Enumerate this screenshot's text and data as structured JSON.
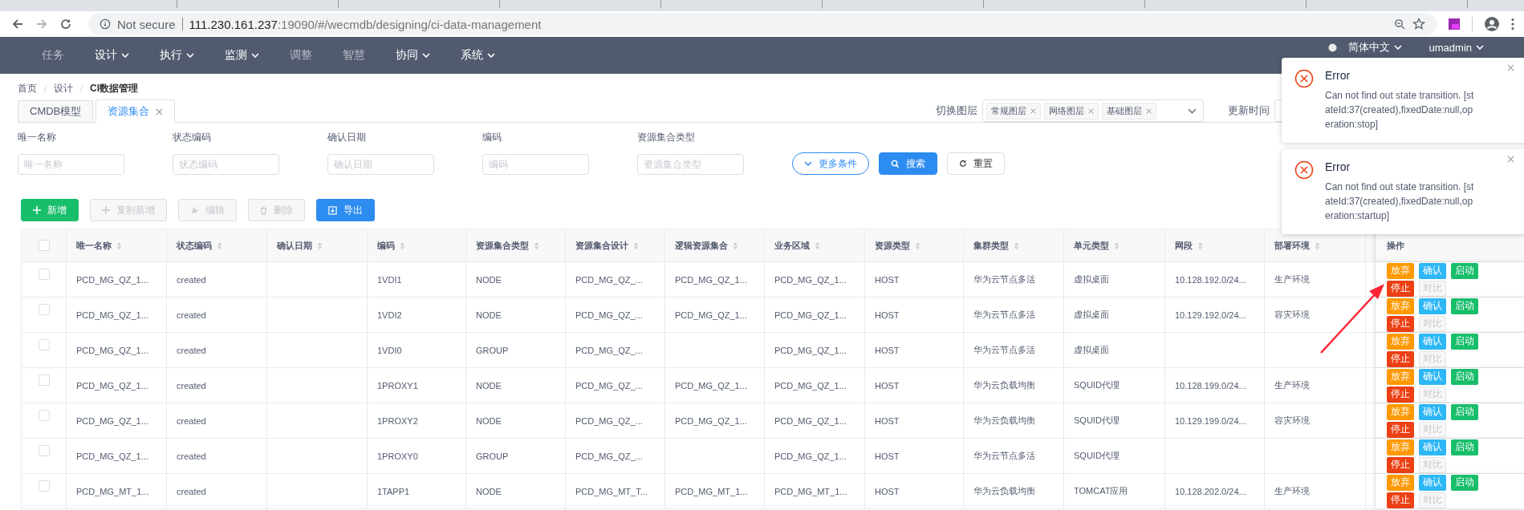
{
  "browser": {
    "security": "Not secure",
    "url_host": "111.230.161.237",
    "url_rest": ":19090/#/wecmdb/designing/ci-data-management"
  },
  "nav": {
    "items": [
      {
        "label": "任务",
        "has_menu": false,
        "dim": true
      },
      {
        "label": "设计",
        "has_menu": true,
        "dim": false
      },
      {
        "label": "执行",
        "has_menu": true,
        "dim": false
      },
      {
        "label": "监测",
        "has_menu": true,
        "dim": false
      },
      {
        "label": "调整",
        "has_menu": false,
        "dim": true
      },
      {
        "label": "智慧",
        "has_menu": false,
        "dim": true
      },
      {
        "label": "协同",
        "has_menu": true,
        "dim": false
      },
      {
        "label": "系统",
        "has_menu": true,
        "dim": false
      }
    ],
    "language": "简体中文",
    "user": "umadmin"
  },
  "breadcrumb": [
    {
      "label": "首页",
      "current": false
    },
    {
      "label": "设计",
      "current": false
    },
    {
      "label": "CI数据管理",
      "current": true
    }
  ],
  "tabs": [
    {
      "label": "CMDB模型",
      "selected": false,
      "closable": false
    },
    {
      "label": "资源集合",
      "selected": true,
      "closable": true
    }
  ],
  "layer_switch": {
    "label": "切换图层",
    "tags": [
      "常规图层",
      "网络图层",
      "基础图层"
    ]
  },
  "update_time": {
    "label": "更新时间"
  },
  "filters": [
    {
      "label": "唯一名称",
      "placeholder": "唯一名称"
    },
    {
      "label": "状态编码",
      "placeholder": "状态编码"
    },
    {
      "label": "确认日期",
      "placeholder": "确认日期"
    },
    {
      "label": "编码",
      "placeholder": "编码"
    },
    {
      "label": "资源集合类型",
      "placeholder": "资源集合类型"
    }
  ],
  "filter_buttons": [
    {
      "label": "更多条件",
      "kind": "more"
    },
    {
      "label": "搜索",
      "kind": "search"
    },
    {
      "label": "重置",
      "kind": "reset"
    }
  ],
  "toolbar": [
    {
      "label": "新增",
      "kind": "add",
      "disabled": false
    },
    {
      "label": "复制新增",
      "kind": "copy",
      "disabled": true
    },
    {
      "label": "编辑",
      "kind": "edit",
      "disabled": true
    },
    {
      "label": "删除",
      "kind": "delete",
      "disabled": true
    },
    {
      "label": "导出",
      "kind": "export",
      "disabled": false
    }
  ],
  "table": {
    "header_checked": false,
    "columns": [
      "唯一名称",
      "状态编码",
      "确认日期",
      "编码",
      "资源集合类型",
      "资源集合设计",
      "逻辑资源集合",
      "业务区域",
      "资源类型",
      "集群类型",
      "单元类型",
      "网段",
      "部署环境"
    ],
    "actions_column": "操作",
    "rows": [
      {
        "selected": false,
        "cells": [
          "PCD_MG_QZ_1...",
          "created",
          null,
          "1VDI1",
          "NODE",
          "PCD_MG_QZ_...",
          "PCD_MG_QZ_1...",
          "PCD_MG_QZ_1...",
          "HOST",
          "华为云节点多活",
          "虚拟桌面",
          "10.128.192.0/24...",
          "生产环境"
        ],
        "actions": [
          {
            "label": "放弃",
            "kind": "abandon",
            "disabled": false
          },
          {
            "label": "确认",
            "kind": "confirm",
            "disabled": false
          },
          {
            "label": "启动",
            "kind": "start",
            "disabled": false
          },
          {
            "label": "停止",
            "kind": "stop",
            "disabled": false
          },
          {
            "label": "对比",
            "kind": "compare",
            "disabled": true
          }
        ]
      },
      {
        "selected": false,
        "cells": [
          "PCD_MG_QZ_1...",
          "created",
          null,
          "1VDI2",
          "NODE",
          "PCD_MG_QZ_...",
          "PCD_MG_QZ_1...",
          "PCD_MG_QZ_1...",
          "HOST",
          "华为云节点多活",
          "虚拟桌面",
          "10.129.192.0/24...",
          "容灾环境"
        ],
        "actions": [
          {
            "label": "放弃",
            "kind": "abandon",
            "disabled": false
          },
          {
            "label": "确认",
            "kind": "confirm",
            "disabled": false
          },
          {
            "label": "启动",
            "kind": "start",
            "disabled": false
          },
          {
            "label": "停止",
            "kind": "stop",
            "disabled": false
          },
          {
            "label": "对比",
            "kind": "compare",
            "disabled": true
          }
        ]
      },
      {
        "selected": false,
        "cells": [
          "PCD_MG_QZ_1...",
          "created",
          null,
          "1VDI0",
          "GROUP",
          "PCD_MG_QZ_...",
          null,
          "PCD_MG_QZ_1...",
          "HOST",
          "华为云节点多活",
          "虚拟桌面",
          null,
          null
        ],
        "actions": [
          {
            "label": "放弃",
            "kind": "abandon",
            "disabled": false
          },
          {
            "label": "确认",
            "kind": "confirm",
            "disabled": false
          },
          {
            "label": "启动",
            "kind": "start",
            "disabled": false
          },
          {
            "label": "停止",
            "kind": "stop",
            "disabled": false
          },
          {
            "label": "对比",
            "kind": "compare",
            "disabled": true
          }
        ]
      },
      {
        "selected": false,
        "cells": [
          "PCD_MG_QZ_1...",
          "created",
          null,
          "1PROXY1",
          "NODE",
          "PCD_MG_QZ_...",
          "PCD_MG_QZ_1...",
          "PCD_MG_QZ_1...",
          "HOST",
          "华为云负载均衡",
          "SQUID代理",
          "10.128.199.0/24...",
          "生产环境"
        ],
        "actions": [
          {
            "label": "放弃",
            "kind": "abandon",
            "disabled": false
          },
          {
            "label": "确认",
            "kind": "confirm",
            "disabled": false
          },
          {
            "label": "启动",
            "kind": "start",
            "disabled": false
          },
          {
            "label": "停止",
            "kind": "stop",
            "disabled": false
          },
          {
            "label": "对比",
            "kind": "compare",
            "disabled": true
          }
        ]
      },
      {
        "selected": false,
        "cells": [
          "PCD_MG_QZ_1...",
          "created",
          null,
          "1PROXY2",
          "NODE",
          "PCD_MG_QZ_...",
          "PCD_MG_QZ_1...",
          "PCD_MG_QZ_1...",
          "HOST",
          "华为云负载均衡",
          "SQUID代理",
          "10.129.199.0/24...",
          "容灾环境"
        ],
        "actions": [
          {
            "label": "放弃",
            "kind": "abandon",
            "disabled": false
          },
          {
            "label": "确认",
            "kind": "confirm",
            "disabled": false
          },
          {
            "label": "启动",
            "kind": "start",
            "disabled": false
          },
          {
            "label": "停止",
            "kind": "stop",
            "disabled": false
          },
          {
            "label": "对比",
            "kind": "compare",
            "disabled": true
          }
        ]
      },
      {
        "selected": false,
        "cells": [
          "PCD_MG_QZ_1...",
          "created",
          null,
          "1PROXY0",
          "GROUP",
          "PCD_MG_QZ_...",
          null,
          "PCD_MG_QZ_1...",
          "HOST",
          "华为云节点多活",
          "SQUID代理",
          null,
          null
        ],
        "actions": [
          {
            "label": "放弃",
            "kind": "abandon",
            "disabled": false
          },
          {
            "label": "确认",
            "kind": "confirm",
            "disabled": false
          },
          {
            "label": "启动",
            "kind": "start",
            "disabled": false
          },
          {
            "label": "停止",
            "kind": "stop",
            "disabled": false
          },
          {
            "label": "对比",
            "kind": "compare",
            "disabled": true
          }
        ]
      },
      {
        "selected": false,
        "cells": [
          "PCD_MG_MT_1...",
          "created",
          null,
          "1TAPP1",
          "NODE",
          "PCD_MG_MT_T...",
          "PCD_MG_MT_1...",
          "PCD_MG_MT_1...",
          "HOST",
          "华为云负载均衡",
          "TOMCAT应用",
          "10.128.202.0/24...",
          "生产环境"
        ],
        "actions": [
          {
            "label": "放弃",
            "kind": "abandon",
            "disabled": false
          },
          {
            "label": "确认",
            "kind": "confirm",
            "disabled": false
          },
          {
            "label": "启动",
            "kind": "start",
            "disabled": false
          },
          {
            "label": "停止",
            "kind": "stop",
            "disabled": false
          },
          {
            "label": "对比",
            "kind": "compare",
            "disabled": true
          }
        ]
      }
    ]
  },
  "notifications": [
    {
      "title": "Error",
      "message": "Can not find out state transition. [stateId:37(created),fixedDate:null,operation:stop]"
    },
    {
      "title": "Error",
      "message": "Can not find out state transition. [stateId:37(created),fixedDate:null,operation:startup]"
    }
  ],
  "annotation": {
    "kind": "arrow"
  }
}
